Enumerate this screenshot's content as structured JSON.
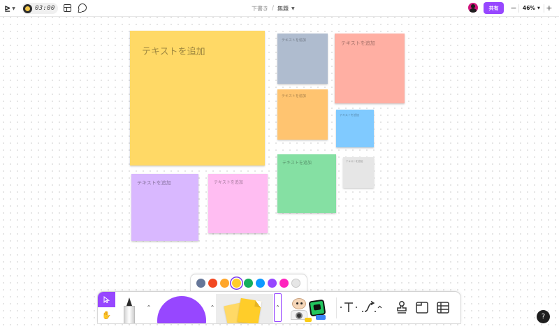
{
  "topbar": {
    "logo_glyph": "⊵",
    "timer": "03:00",
    "breadcrumb_folder": "下書き",
    "breadcrumb_separator": "/",
    "file_name": "無題",
    "share_label": "共有",
    "zoom_minus": "−",
    "zoom_level": "46%",
    "zoom_plus": "+"
  },
  "stickies": [
    {
      "label": "テキストを追加",
      "color": "#ffd966"
    },
    {
      "label": "テキストを追加",
      "color": "#afbccf"
    },
    {
      "label": "テキストを追加",
      "color": "#ffafa3"
    },
    {
      "label": "テキストを追加",
      "color": "#ffc470"
    },
    {
      "label": "テキストを追加",
      "color": "#80caff"
    },
    {
      "label": "テキストを追加",
      "color": "#d9b8ff"
    },
    {
      "label": "テキストを追加",
      "color": "#ffbdf2"
    },
    {
      "label": "テキストを追加",
      "color": "#85e0a3"
    },
    {
      "label": "テキストを追加",
      "color": "#e6e6e6"
    }
  ],
  "color_picker": {
    "swatches": [
      "#667799",
      "#f24822",
      "#ffa629",
      "#ffcd29",
      "#14ae5c",
      "#0d99ff",
      "#9747ff",
      "#ff24bd",
      "#e6e6e6"
    ],
    "selected_index": 3
  },
  "toolbar": {
    "accent_color": "#9747ff",
    "caret_up": "⌃"
  },
  "help": {
    "label": "?"
  }
}
